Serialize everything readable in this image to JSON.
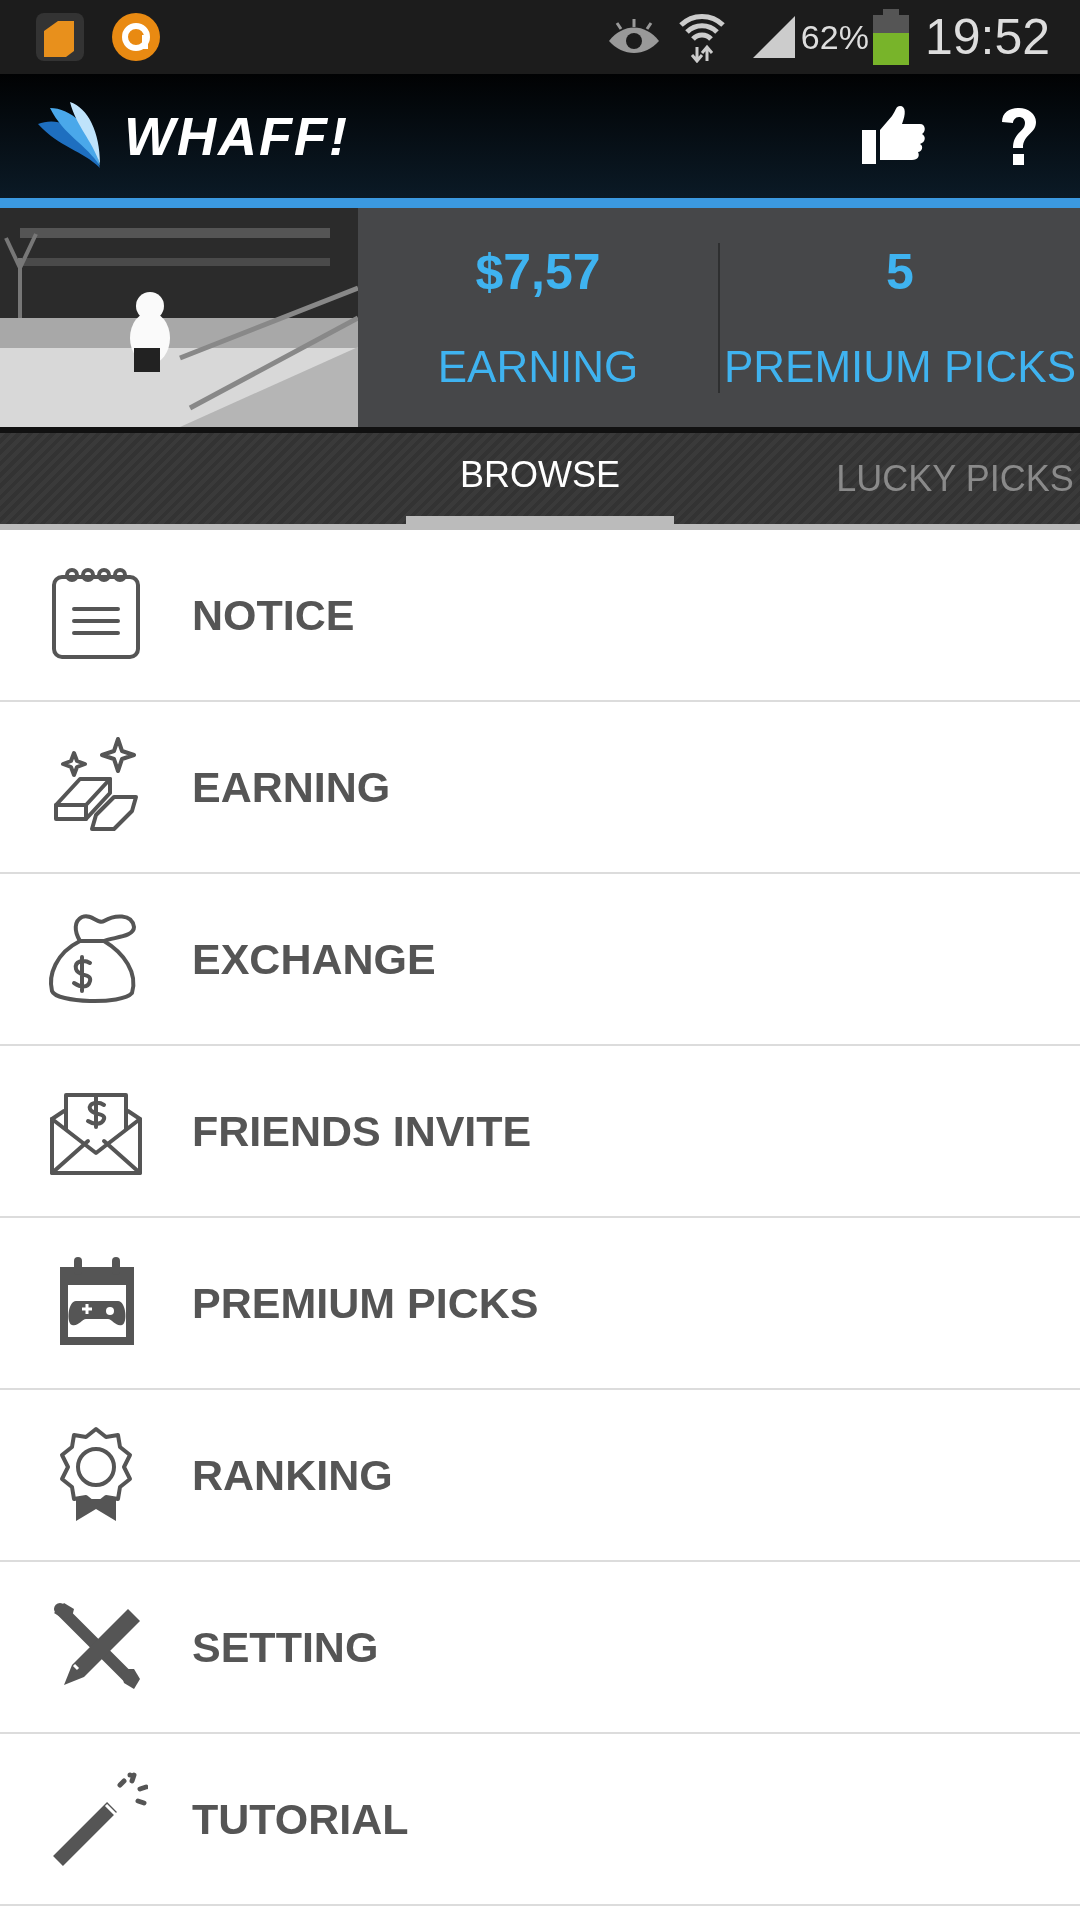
{
  "status_bar": {
    "battery": "62%",
    "time": "19:52"
  },
  "app_bar": {
    "title": "WHAFF!"
  },
  "summary": [
    {
      "value": "$7,57",
      "label": "EARNING"
    },
    {
      "value": "5",
      "label": "PREMIUM PICKS"
    }
  ],
  "tabs": [
    {
      "label": "BROWSE",
      "selected": true
    },
    {
      "label": "LUCKY PICKS",
      "selected": false
    }
  ],
  "menu": [
    {
      "label": "NOTICE",
      "kind": "notice"
    },
    {
      "label": "EARNING",
      "kind": "gold"
    },
    {
      "label": "EXCHANGE",
      "kind": "bag"
    },
    {
      "label": "FRIENDS INVITE",
      "kind": "envelope"
    },
    {
      "label": "PREMIUM PICKS",
      "kind": "gamepad"
    },
    {
      "label": "RANKING",
      "kind": "badge"
    },
    {
      "label": "SETTING",
      "kind": "tools"
    },
    {
      "label": "TUTORIAL",
      "kind": "wand"
    }
  ]
}
